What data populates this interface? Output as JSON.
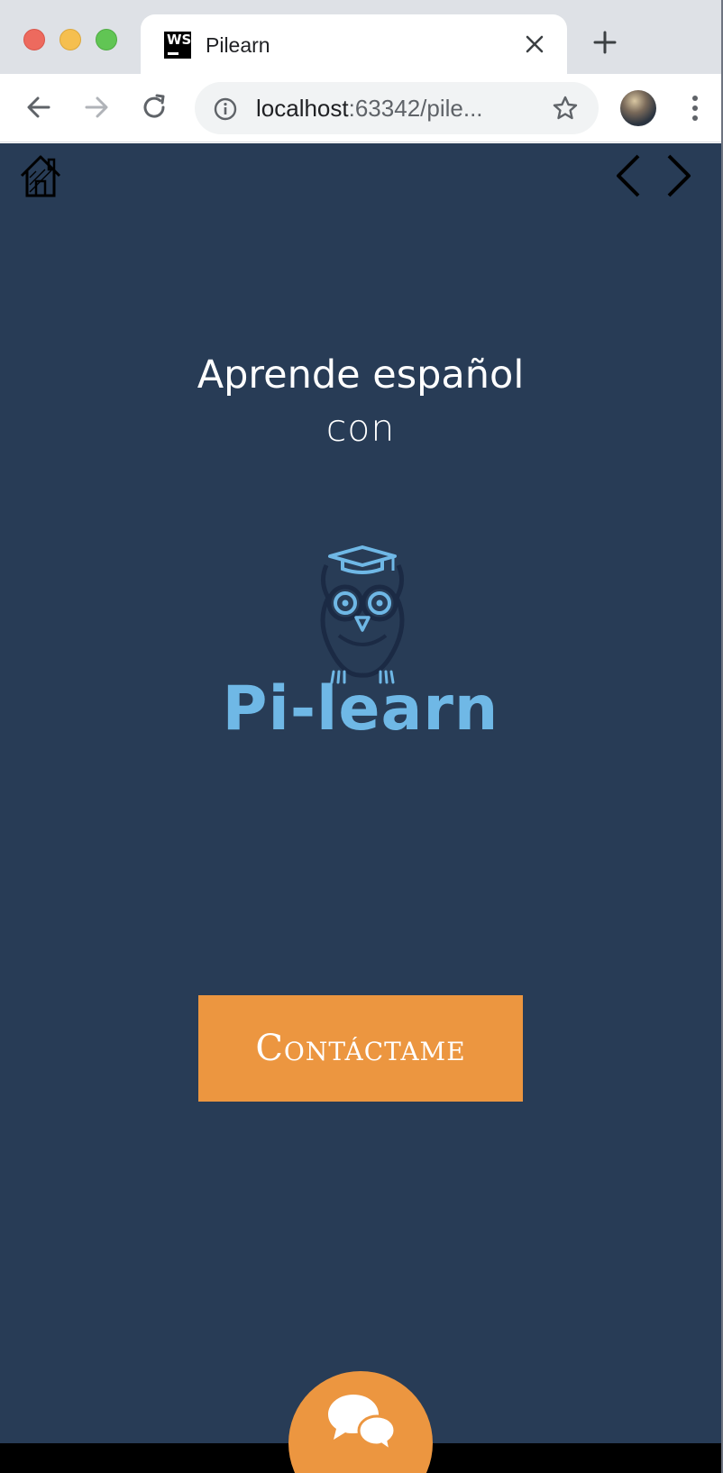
{
  "browser": {
    "tab": {
      "favicon_text": "WS",
      "title": "Pilearn"
    },
    "url": {
      "host": "localhost",
      "rest": ":63342/pile..."
    }
  },
  "page": {
    "headline": "Aprende español",
    "subline": "con",
    "logo_text": "Pi-learn",
    "contact_button_label": "Contáctame",
    "colors": {
      "background": "#283c56",
      "accent": "#ec9640",
      "logo_blue": "#6fb8e6"
    }
  }
}
